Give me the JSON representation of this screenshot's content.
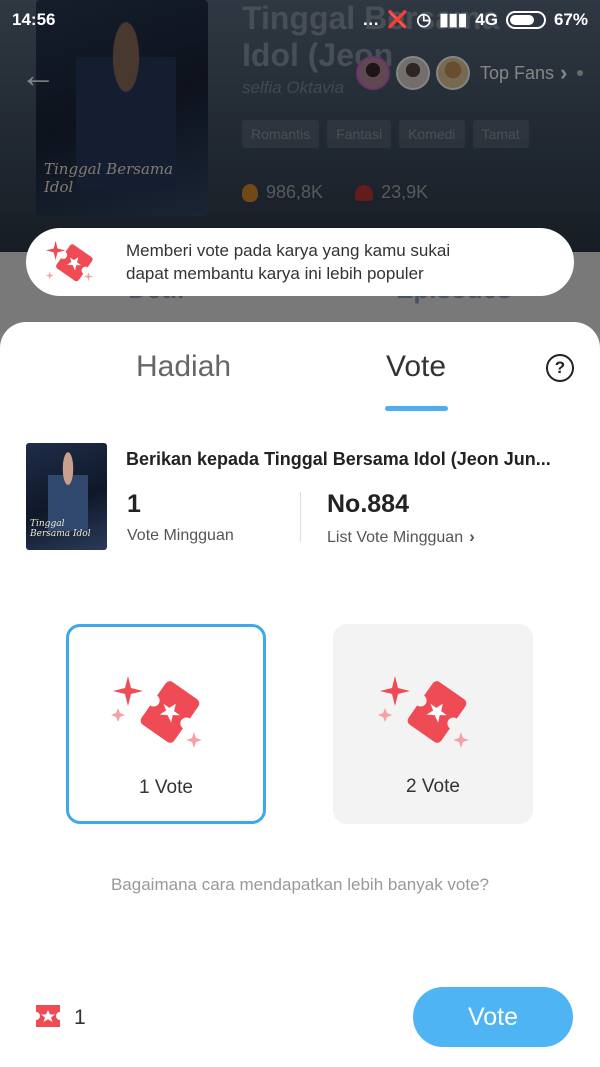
{
  "status_bar": {
    "time": "14:56",
    "network": "4G",
    "battery": "67%"
  },
  "background": {
    "title": "Tinggal Bersama Idol (Jeon",
    "author": "selfia Oktavia",
    "cover_text": "Tinggal Bersama Idol",
    "tags": [
      "Romantis",
      "Fantasi",
      "Komedi",
      "Tamat"
    ],
    "views": "986,8K",
    "likes": "23,9K",
    "top_fans_label": "Top Fans",
    "tabs": [
      "Detil",
      "Episodes"
    ]
  },
  "banner": {
    "line1": "Memberi vote pada karya yang kamu sukai",
    "line2": "dapat membantu karya ini lebih populer"
  },
  "sheet": {
    "tabs": {
      "hadiah": "Hadiah",
      "vote": "Vote"
    },
    "active_tab": "Vote",
    "help_glyph": "?",
    "book": {
      "cover_text": "Tinggal Bersama Idol",
      "title": "Berikan kepada Tinggal Bersama Idol (Jeon Jun..."
    },
    "weekly_votes": {
      "value": "1",
      "label": "Vote Mingguan"
    },
    "weekly_rank": {
      "value": "No.884",
      "label": "List Vote Mingguan"
    },
    "options": [
      {
        "label": "1 Vote",
        "selected": true
      },
      {
        "label": "2 Vote",
        "selected": false
      }
    ],
    "help_link": "Bagaimana cara mendapatkan lebih banyak vote?",
    "balance": "1",
    "vote_button": "Vote"
  },
  "colors": {
    "accent": "#4eb4f4",
    "ticket": "#ef4b55"
  }
}
